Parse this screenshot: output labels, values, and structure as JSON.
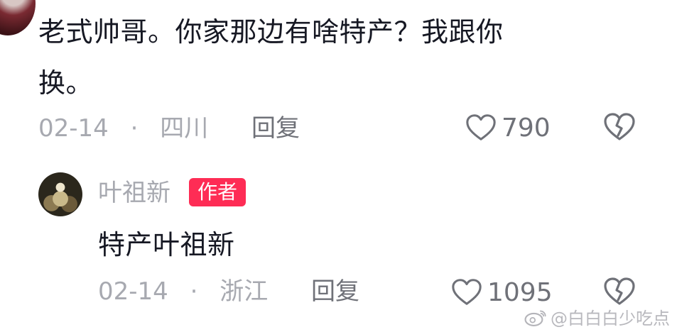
{
  "comment1": {
    "text_line1": "老式帅哥。你家那边有啥特产？我跟你",
    "text_line2": "换。",
    "date": "02-14",
    "separator": "·",
    "location": "四川",
    "reply_label": "回复",
    "likes": "790",
    "like_icon": "heart-outline-icon",
    "dislike_icon": "broken-heart-icon"
  },
  "reply": {
    "author_name": "叶祖新",
    "author_badge": "作者",
    "text": "特产叶祖新",
    "date": "02-14",
    "separator": "·",
    "location": "浙江",
    "reply_label": "回复",
    "likes": "1095",
    "like_icon": "heart-outline-icon",
    "dislike_icon": "broken-heart-icon"
  },
  "watermark": {
    "text": "@白白白少吃点",
    "icon": "weibo-icon"
  },
  "colors": {
    "text": "#161823",
    "meta": "#a7a9b0",
    "badge": "#fe2c55"
  }
}
